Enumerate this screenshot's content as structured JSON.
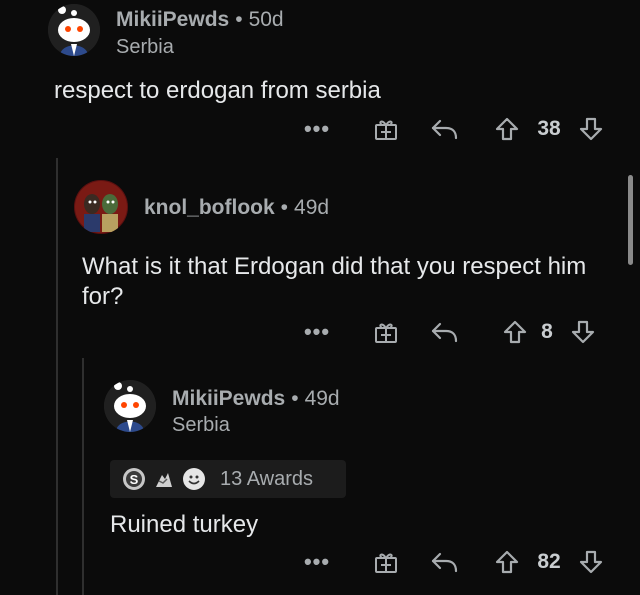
{
  "comments": [
    {
      "username": "MikiiPewds",
      "age": "50d",
      "flair": "Serbia",
      "body": "respect to erdogan from serbia",
      "votes": "38",
      "more": "•••"
    },
    {
      "username": "knol_boflook",
      "age": "49d",
      "flair": "",
      "body": "What is it that Erdogan did that you respect him for?",
      "votes": "8",
      "more": "•••"
    },
    {
      "username": "MikiiPewds",
      "age": "49d",
      "flair": "Serbia",
      "awards": "13 Awards",
      "body": "Ruined turkey",
      "votes": "82",
      "more": "•••"
    }
  ],
  "separator": "•",
  "icons": [
    "gift-icon",
    "reply-icon",
    "upvote-icon",
    "downvote-icon"
  ]
}
